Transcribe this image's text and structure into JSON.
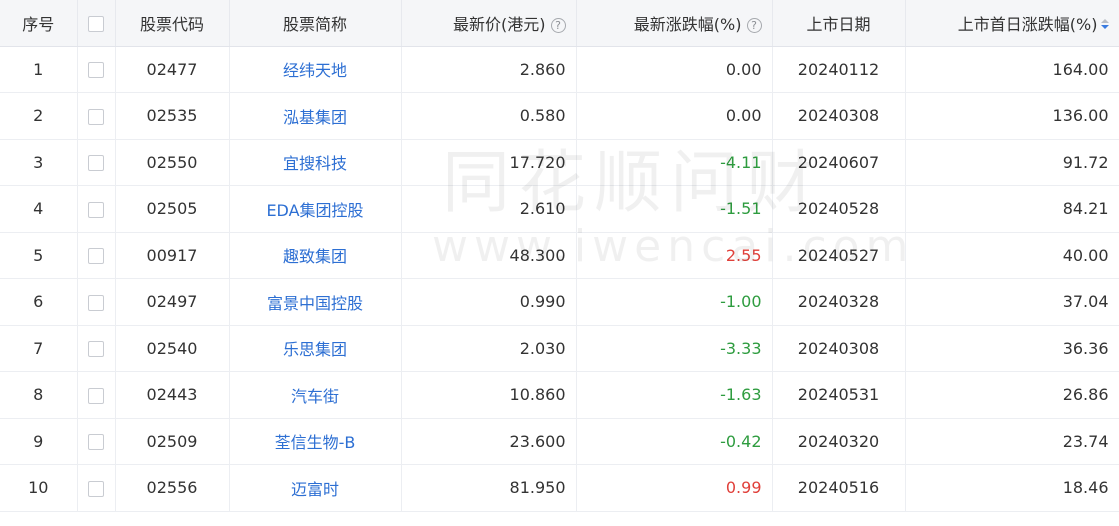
{
  "columns": {
    "index": "序号",
    "code": "股票代码",
    "name": "股票简称",
    "price": "最新价(港元)",
    "change": "最新涨跌幅(%)",
    "list_date": "上市日期",
    "first_day_change": "上市首日涨跌幅(%)"
  },
  "help_glyph": "?",
  "sort_state": "descending",
  "watermark": {
    "line1": "同花顺问财",
    "line2": "www.iwencai.com"
  },
  "colors": {
    "link": "#2d6fd3",
    "negative": "#2e9c3f",
    "positive": "#e0403a"
  },
  "rows": [
    {
      "index": "1",
      "code": "02477",
      "name": "经纬天地",
      "price": "2.860",
      "change": "0.00",
      "change_dir": "zero",
      "list_date": "20240112",
      "first_day_change": "164.00"
    },
    {
      "index": "2",
      "code": "02535",
      "name": "泓基集团",
      "price": "0.580",
      "change": "0.00",
      "change_dir": "zero",
      "list_date": "20240308",
      "first_day_change": "136.00"
    },
    {
      "index": "3",
      "code": "02550",
      "name": "宜搜科技",
      "price": "17.720",
      "change": "-4.11",
      "change_dir": "neg",
      "list_date": "20240607",
      "first_day_change": "91.72"
    },
    {
      "index": "4",
      "code": "02505",
      "name": "EDA集团控股",
      "price": "2.610",
      "change": "-1.51",
      "change_dir": "neg",
      "list_date": "20240528",
      "first_day_change": "84.21"
    },
    {
      "index": "5",
      "code": "00917",
      "name": "趣致集团",
      "price": "48.300",
      "change": "2.55",
      "change_dir": "pos",
      "list_date": "20240527",
      "first_day_change": "40.00"
    },
    {
      "index": "6",
      "code": "02497",
      "name": "富景中国控股",
      "price": "0.990",
      "change": "-1.00",
      "change_dir": "neg",
      "list_date": "20240328",
      "first_day_change": "37.04"
    },
    {
      "index": "7",
      "code": "02540",
      "name": "乐思集团",
      "price": "2.030",
      "change": "-3.33",
      "change_dir": "neg",
      "list_date": "20240308",
      "first_day_change": "36.36"
    },
    {
      "index": "8",
      "code": "02443",
      "name": "汽车街",
      "price": "10.860",
      "change": "-1.63",
      "change_dir": "neg",
      "list_date": "20240531",
      "first_day_change": "26.86"
    },
    {
      "index": "9",
      "code": "02509",
      "name": "荃信生物-B",
      "price": "23.600",
      "change": "-0.42",
      "change_dir": "neg",
      "list_date": "20240320",
      "first_day_change": "23.74"
    },
    {
      "index": "10",
      "code": "02556",
      "name": "迈富时",
      "price": "81.950",
      "change": "0.99",
      "change_dir": "pos",
      "list_date": "20240516",
      "first_day_change": "18.46"
    }
  ]
}
